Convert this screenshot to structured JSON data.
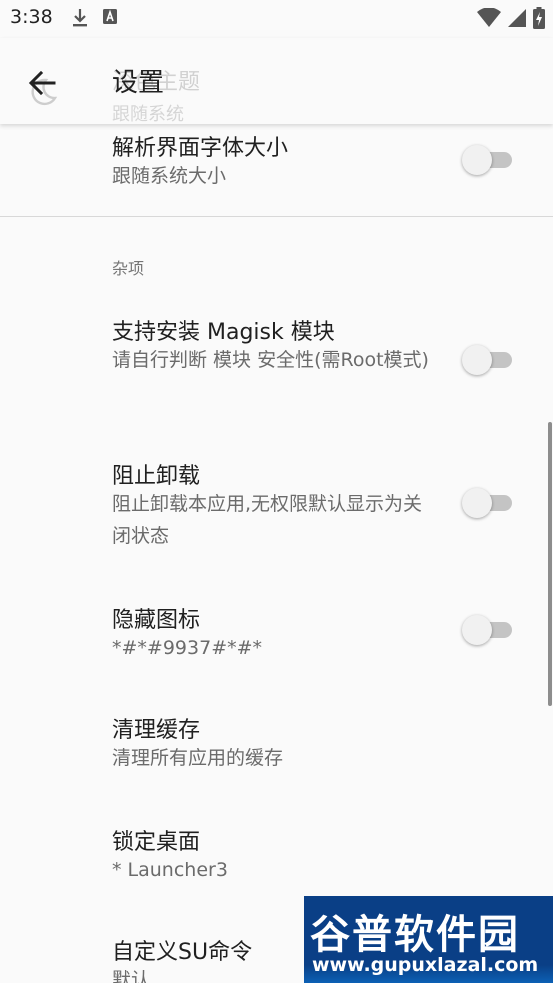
{
  "status_bar": {
    "time": "3:38",
    "left_icons": [
      "download-icon",
      "a-notification-icon"
    ],
    "right_icons": [
      "wifi-icon",
      "signal-icon",
      "battery-charging-icon"
    ]
  },
  "app_bar": {
    "title": "设置",
    "behind_item_title": "深色主题",
    "behind_item_subtitle": "跟随系统"
  },
  "preferences": [
    {
      "id": "font-size",
      "title": "解析界面字体大小",
      "subtitle": "跟随系统大小",
      "has_switch": true,
      "checked": false
    }
  ],
  "category": {
    "label": "杂项"
  },
  "misc_preferences": [
    {
      "id": "magisk",
      "title": "支持安装 Magisk 模块",
      "subtitle": "请自行判断 模块 安全性(需Root模式)",
      "has_switch": true,
      "checked": false
    },
    {
      "id": "prevent-uninstall",
      "title": "阻止卸载",
      "subtitle": "阻止卸载本应用,无权限默认显示为关闭状态",
      "has_switch": true,
      "checked": false
    },
    {
      "id": "hide-icon",
      "title": "隐藏图标",
      "subtitle": "*#*#9937#*#*",
      "has_switch": true,
      "checked": false
    },
    {
      "id": "clear-cache",
      "title": "清理缓存",
      "subtitle": "清理所有应用的缓存",
      "has_switch": false
    },
    {
      "id": "lock-launcher",
      "title": "锁定桌面",
      "subtitle": "* Launcher3",
      "has_switch": false
    },
    {
      "id": "custom-su",
      "title": "自定义SU命令",
      "subtitle": "默认",
      "has_switch": false
    }
  ],
  "watermark": {
    "cn": "谷普软件园",
    "url": "www.gupuxlazal.com"
  },
  "colors": {
    "background": "#fafafa",
    "switch_track": "#c4c4c4",
    "switch_thumb": "#f1f1f1",
    "watermark": "#0a3f86"
  }
}
